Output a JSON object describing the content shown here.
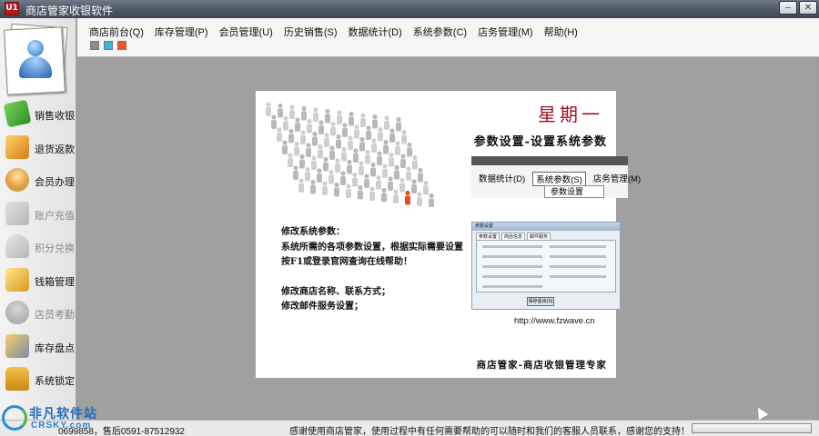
{
  "window": {
    "title": "商店管家收银软件",
    "app_icon_text": "U1",
    "controls": {
      "minimize": "–",
      "close": "✕"
    }
  },
  "menubar": {
    "items": [
      "商店前台(Q)",
      "库存管理(P)",
      "会员管理(U)",
      "历史销售(S)",
      "数据统计(D)",
      "系统参数(C)",
      "店务管理(M)",
      "帮助(H)"
    ],
    "theme_swatches": [
      "#8c8c8c",
      "#3cb5de",
      "#f0531f"
    ]
  },
  "sidebar": {
    "avatar_icon": "user-profile-icon",
    "items": [
      {
        "label": "销售收银",
        "icon": "sale-tag-icon",
        "enabled": true
      },
      {
        "label": "退货返款",
        "icon": "return-box-icon",
        "enabled": true
      },
      {
        "label": "会员办理",
        "icon": "member-icon",
        "enabled": true
      },
      {
        "label": "账户充值",
        "icon": "recharge-card-icon",
        "enabled": false
      },
      {
        "label": "积分兑换",
        "icon": "points-exchange-icon",
        "enabled": false
      },
      {
        "label": "钱箱管理",
        "icon": "cash-drawer-icon",
        "enabled": true
      },
      {
        "label": "店员考勤",
        "icon": "staff-attendance-icon",
        "enabled": false
      },
      {
        "label": "库存盘点",
        "icon": "inventory-icon",
        "enabled": true
      },
      {
        "label": "系统锁定",
        "icon": "lock-icon",
        "enabled": true
      }
    ]
  },
  "banner": {
    "weekday": "星期一",
    "subtitle": "参数设置-设置系统参数",
    "instructions": [
      "修改系统参数：",
      "系统所需的各项参数设置，根据实际需要设置",
      "按F1或登录官网查询在线帮助！",
      "",
      "修改商店名称、联系方式；",
      "修改邮件服务设置；"
    ],
    "mini_menu": {
      "items": [
        "数据统计(D)",
        "系统参数(S)",
        "店务管理(M)"
      ],
      "submenu_item": "参数设置"
    },
    "mini_dialog": {
      "title": "参数设置",
      "tabs": [
        "参数设置",
        "商店信息",
        "邮件服务"
      ],
      "save_button": "保存退出(S)"
    },
    "url": "http://www.fzwave.cn",
    "slogan": "商店管家-商店收银管理专家"
  },
  "statusbar": {
    "contact": "0699858，售后0591-87512932",
    "message": "感谢使用商店管家，使用过程中有任何需要帮助的可以随时和我们的客服人员联系，感谢您的支持！",
    "progress": 0
  },
  "watermark": {
    "line1": "非凡软件站",
    "line2": "CRSKY.com"
  },
  "colors": {
    "workspace_bg": "#a0a0a0",
    "title_red": "#a01020",
    "highlight_person": "#e2521c"
  }
}
